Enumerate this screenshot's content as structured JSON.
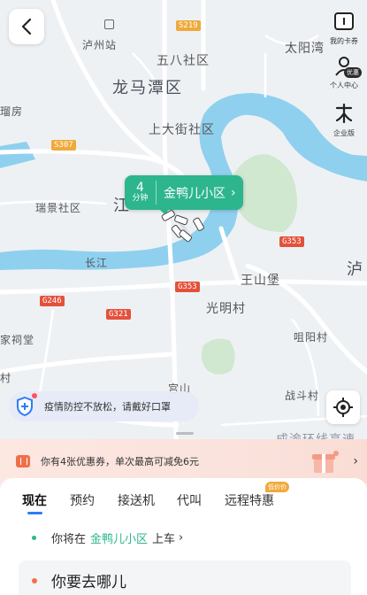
{
  "map": {
    "labels": {
      "luzhou_station": "泸州站",
      "wuba_community": "五八社区",
      "longmatan": "龙马潭区",
      "taiyangwan": "太阳湾",
      "shangdajie": "上大街社区",
      "ruijing": "瑞景社区",
      "jiang": "江",
      "changjiang": "长江",
      "wangshanbao": "王山堡",
      "guangming": "光明村",
      "yanyangcun": "咀阳村",
      "zhanghutang": "家祠堂",
      "shicun": "村",
      "zhandoucun": "战斗村",
      "lu": "泸",
      "fangcun": "瑠房",
      "gongshan": "宫山",
      "bottom_road": "成渝环线高速"
    },
    "roads": {
      "s219": "S219",
      "s307": "S307",
      "g353_a": "G353",
      "g353_b": "G353",
      "g246": "G246",
      "g321": "G321"
    }
  },
  "header": {
    "back_icon": "chevron-left-icon"
  },
  "side_buttons": [
    {
      "label": "我的卡券",
      "icon": "card-icon"
    },
    {
      "label": "个人中心",
      "icon": "user-icon",
      "badge": "优惠"
    },
    {
      "label": "企业版",
      "icon": "enterprise-icon"
    }
  ],
  "pickup_pill": {
    "eta_number": "4",
    "eta_unit": "分钟",
    "place": "金鸭儿小区",
    "arrow": "›"
  },
  "notice": {
    "text": "疫情防控不放松，请戴好口罩",
    "icon": "shield-icon"
  },
  "coupon": {
    "text": "你有4张优惠券，单次最高可减免6元",
    "arrow": "›"
  },
  "tabs": [
    {
      "label": "现在",
      "active": true
    },
    {
      "label": "预约",
      "active": false
    },
    {
      "label": "接送机",
      "active": false
    },
    {
      "label": "代叫",
      "active": false
    },
    {
      "label": "远程特惠",
      "active": false
    }
  ],
  "tab_badge": "低价价",
  "pickup_row": {
    "prefix": "你将在",
    "place": "金鸭儿小区",
    "suffix": "上车",
    "arrow": "›"
  },
  "destination": {
    "placeholder": "你要去哪儿"
  },
  "colors": {
    "accent_green": "#2db58e",
    "accent_blue": "#2d7cf6",
    "accent_orange": "#f07049"
  }
}
